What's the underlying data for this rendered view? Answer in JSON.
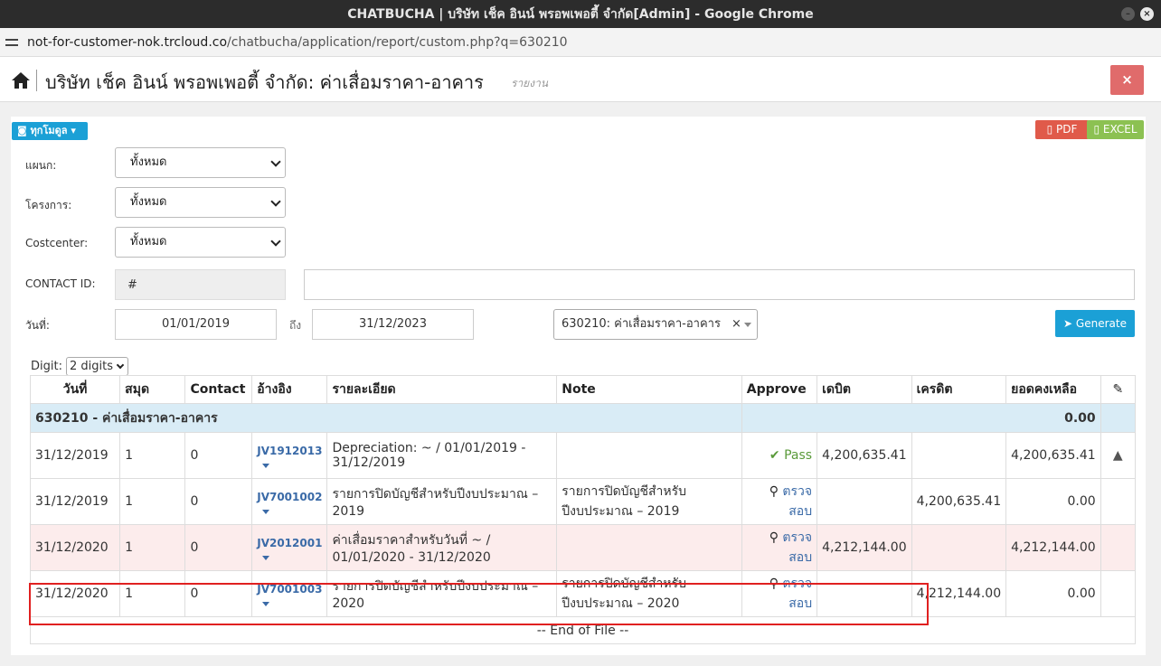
{
  "window": {
    "title": "CHATBUCHA | บริษัท เช็ค อินน์ พรอพเพอตี้ จำกัด[Admin] - Google Chrome"
  },
  "url": {
    "host": "not-for-customer-nok.trcloud.co",
    "path": "/chatbucha/application/report/custom.php?q=630210"
  },
  "header": {
    "title": "บริษัท เช็ค อินน์ พรอพเพอตี้ จำกัด: ค่าเสื่อมราคา-อาคาร",
    "subtitle": "รายงาน",
    "close": "×"
  },
  "toolbar": {
    "module": "ทุกโมดูล",
    "pdf": "PDF",
    "excel": "EXCEL"
  },
  "filters": {
    "department_label": "แผนก:",
    "department_value": "ทั้งหมด",
    "project_label": "โครงการ:",
    "project_value": "ทั้งหมด",
    "costcenter_label": "Costcenter:",
    "costcenter_value": "ทั้งหมด",
    "contact_label": "CONTACT ID:",
    "contact_value": "#",
    "date_label": "วันที่:",
    "date_from": "01/01/2019",
    "to_label": "ถึง",
    "date_to": "31/12/2023",
    "account": "630210: ค่าเสื่อมราคา-อาคาร",
    "account_clear": "×",
    "generate": "Generate"
  },
  "digit": {
    "label": "Digit:",
    "value": "2 digits"
  },
  "table": {
    "headers": [
      "วันที่",
      "สมุด",
      "Contact",
      "อ้างอิง",
      "รายละเอียด",
      "Note",
      "Approve",
      "เดบิต",
      "เครดิต",
      "ยอดคงเหลือ"
    ],
    "group": {
      "label": "630210 - ค่าเสื่อมราคา-อาคาร",
      "balance": "0.00"
    },
    "rows": [
      {
        "date": "31/12/2019",
        "book": "1",
        "contact": "0",
        "ref": "JV1912013",
        "detail": "Depreciation: ~ / 01/01/2019 - 31/12/2019",
        "note": "",
        "approve": "Pass",
        "debit": "4,200,635.41",
        "credit": "",
        "balance": "4,200,635.41"
      },
      {
        "date": "31/12/2019",
        "book": "1",
        "contact": "0",
        "ref": "JV7001002",
        "detail": "รายการปิดบัญชีสำหรับปีงบประมาณ – 2019",
        "note": "รายการปิดบัญชีสำหรับ ปีงบประมาณ – 2019",
        "approve": "ตรวจสอบ",
        "debit": "",
        "credit": "4,200,635.41",
        "balance": "0.00"
      },
      {
        "date": "31/12/2020",
        "book": "1",
        "contact": "0",
        "ref": "JV2012001",
        "detail": "ค่าเสื่อมราคาสำหรับวันที่ ~ / 01/01/2020 - 31/12/2020",
        "note": "",
        "approve": "ตรวจสอบ",
        "debit": "4,212,144.00",
        "credit": "",
        "balance": "4,212,144.00"
      },
      {
        "date": "31/12/2020",
        "book": "1",
        "contact": "0",
        "ref": "JV7001003",
        "detail": "รายการปิดบัญชีสำหรับปีงบประมาณ – 2020",
        "note": "รายการปิดบัญชีสำหรับ ปีงบประมาณ – 2020",
        "approve": "ตรวจสอบ",
        "debit": "",
        "credit": "4,212,144.00",
        "balance": "0.00"
      }
    ],
    "eof": "-- End of File --"
  },
  "colors": {
    "accent": "#1ba0d6",
    "danger": "#e06b6b",
    "pdf": "#e05a4a",
    "excel": "#8cc152",
    "group_bg": "#d9ecf6",
    "highlight": "#e02020"
  }
}
